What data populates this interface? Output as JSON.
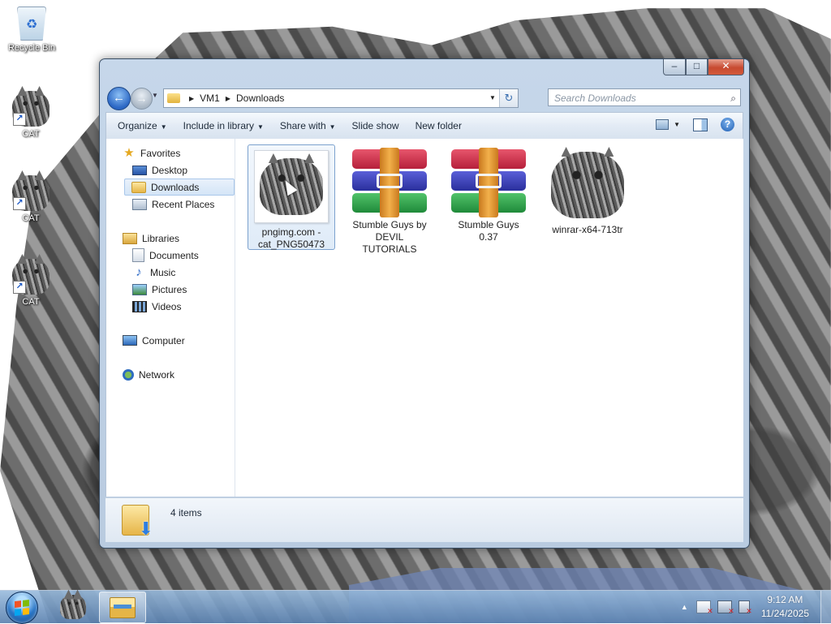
{
  "desktop": {
    "icons": [
      {
        "label": "Recycle Bin",
        "icon": "recycle-bin-icon"
      },
      {
        "label": "CAT",
        "icon": "cat-shortcut-icon"
      },
      {
        "label": "CAT",
        "icon": "cat-shortcut-icon"
      },
      {
        "label": "CAT",
        "icon": "cat-shortcut-icon"
      }
    ]
  },
  "window": {
    "caption_buttons": {
      "minimize": "–",
      "maximize": "□",
      "close": "✕"
    },
    "address": {
      "breadcrumbs": [
        "VM1",
        "Downloads"
      ],
      "search_placeholder": "Search Downloads"
    },
    "toolbar": {
      "organize": "Organize",
      "include_in_library": "Include in library",
      "share_with": "Share with",
      "slide_show": "Slide show",
      "new_folder": "New folder"
    },
    "navigation": {
      "favorites": {
        "label": "Favorites",
        "items": [
          "Desktop",
          "Downloads",
          "Recent Places"
        ]
      },
      "libraries": {
        "label": "Libraries",
        "items": [
          "Documents",
          "Music",
          "Pictures",
          "Videos"
        ]
      },
      "computer": "Computer",
      "network": "Network",
      "selected": "Downloads"
    },
    "files": [
      {
        "name_line1": "pngimg.com -",
        "name_line2": "cat_PNG50473",
        "name_line3": "",
        "type": "image",
        "selected": true
      },
      {
        "name_line1": "Stumble Guys  by",
        "name_line2": "DEVIL",
        "name_line3": "TUTORIALS",
        "type": "rar-archive",
        "selected": false
      },
      {
        "name_line1": "Stumble Guys",
        "name_line2": "0.37",
        "name_line3": "",
        "type": "rar-archive",
        "selected": false
      },
      {
        "name_line1": "winrar-x64-713tr",
        "name_line2": "",
        "name_line3": "",
        "type": "image",
        "selected": false
      }
    ],
    "status": {
      "item_count": "4 items"
    }
  },
  "taskbar": {
    "pinned": [
      "cat-app-icon",
      "windows-explorer-icon"
    ],
    "active": "windows-explorer-icon",
    "clock": {
      "time": "9:12 AM",
      "date": "11/24/2025"
    },
    "tray_arrow": "▲"
  },
  "colors": {
    "accent": "#2a66c4",
    "selection": "#dfebf8",
    "taskbar": "#5c82b0"
  }
}
